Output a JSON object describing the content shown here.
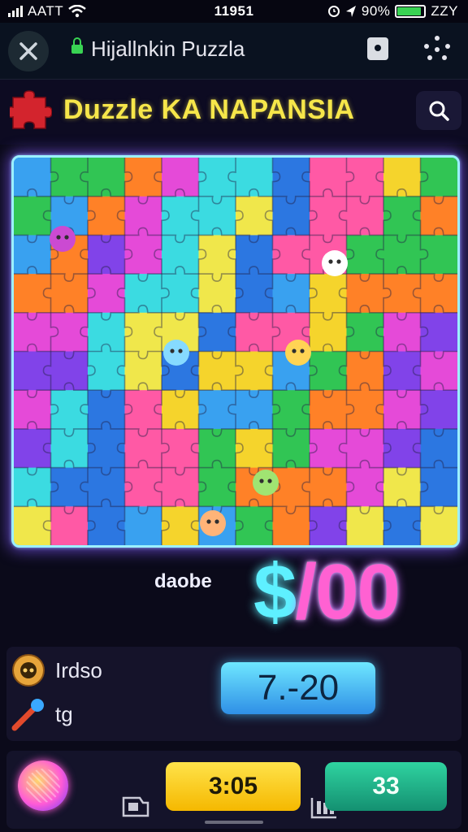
{
  "status_bar": {
    "carrier": "AATT",
    "time": "11951",
    "battery": "90%",
    "network": "ZZY",
    "battery_level": 0.9
  },
  "browser": {
    "title": "Hijallnkin Puzzla",
    "close_icon": "close-icon",
    "extension_icon": "extension-icon",
    "menu_icon": "more-dots-icon"
  },
  "app_header": {
    "title": "Duzzle KA NAPANSIA",
    "logo_icon": "puzzle-piece-icon",
    "search_icon": "search-icon"
  },
  "score": {
    "label": "daobe",
    "value": "$/00"
  },
  "stats": {
    "row1_label": "Irdso",
    "row1_icon": "gear-badge-icon",
    "row2_label": "tg",
    "row2_icon": "wrench-tool-icon",
    "time_range": "7.-20"
  },
  "bottom_bar": {
    "timer": "3:05",
    "count": "33",
    "avatar_icon": "avatar-ball-icon",
    "tray_left_icon": "tray-icon",
    "tray_right_icon": "stack-icon"
  },
  "colors": {
    "accent_yellow": "#f6e64a",
    "neon_pink": "#ff61d2",
    "neon_cyan": "#5ef0ff",
    "board_border": "#9cf0ff"
  }
}
